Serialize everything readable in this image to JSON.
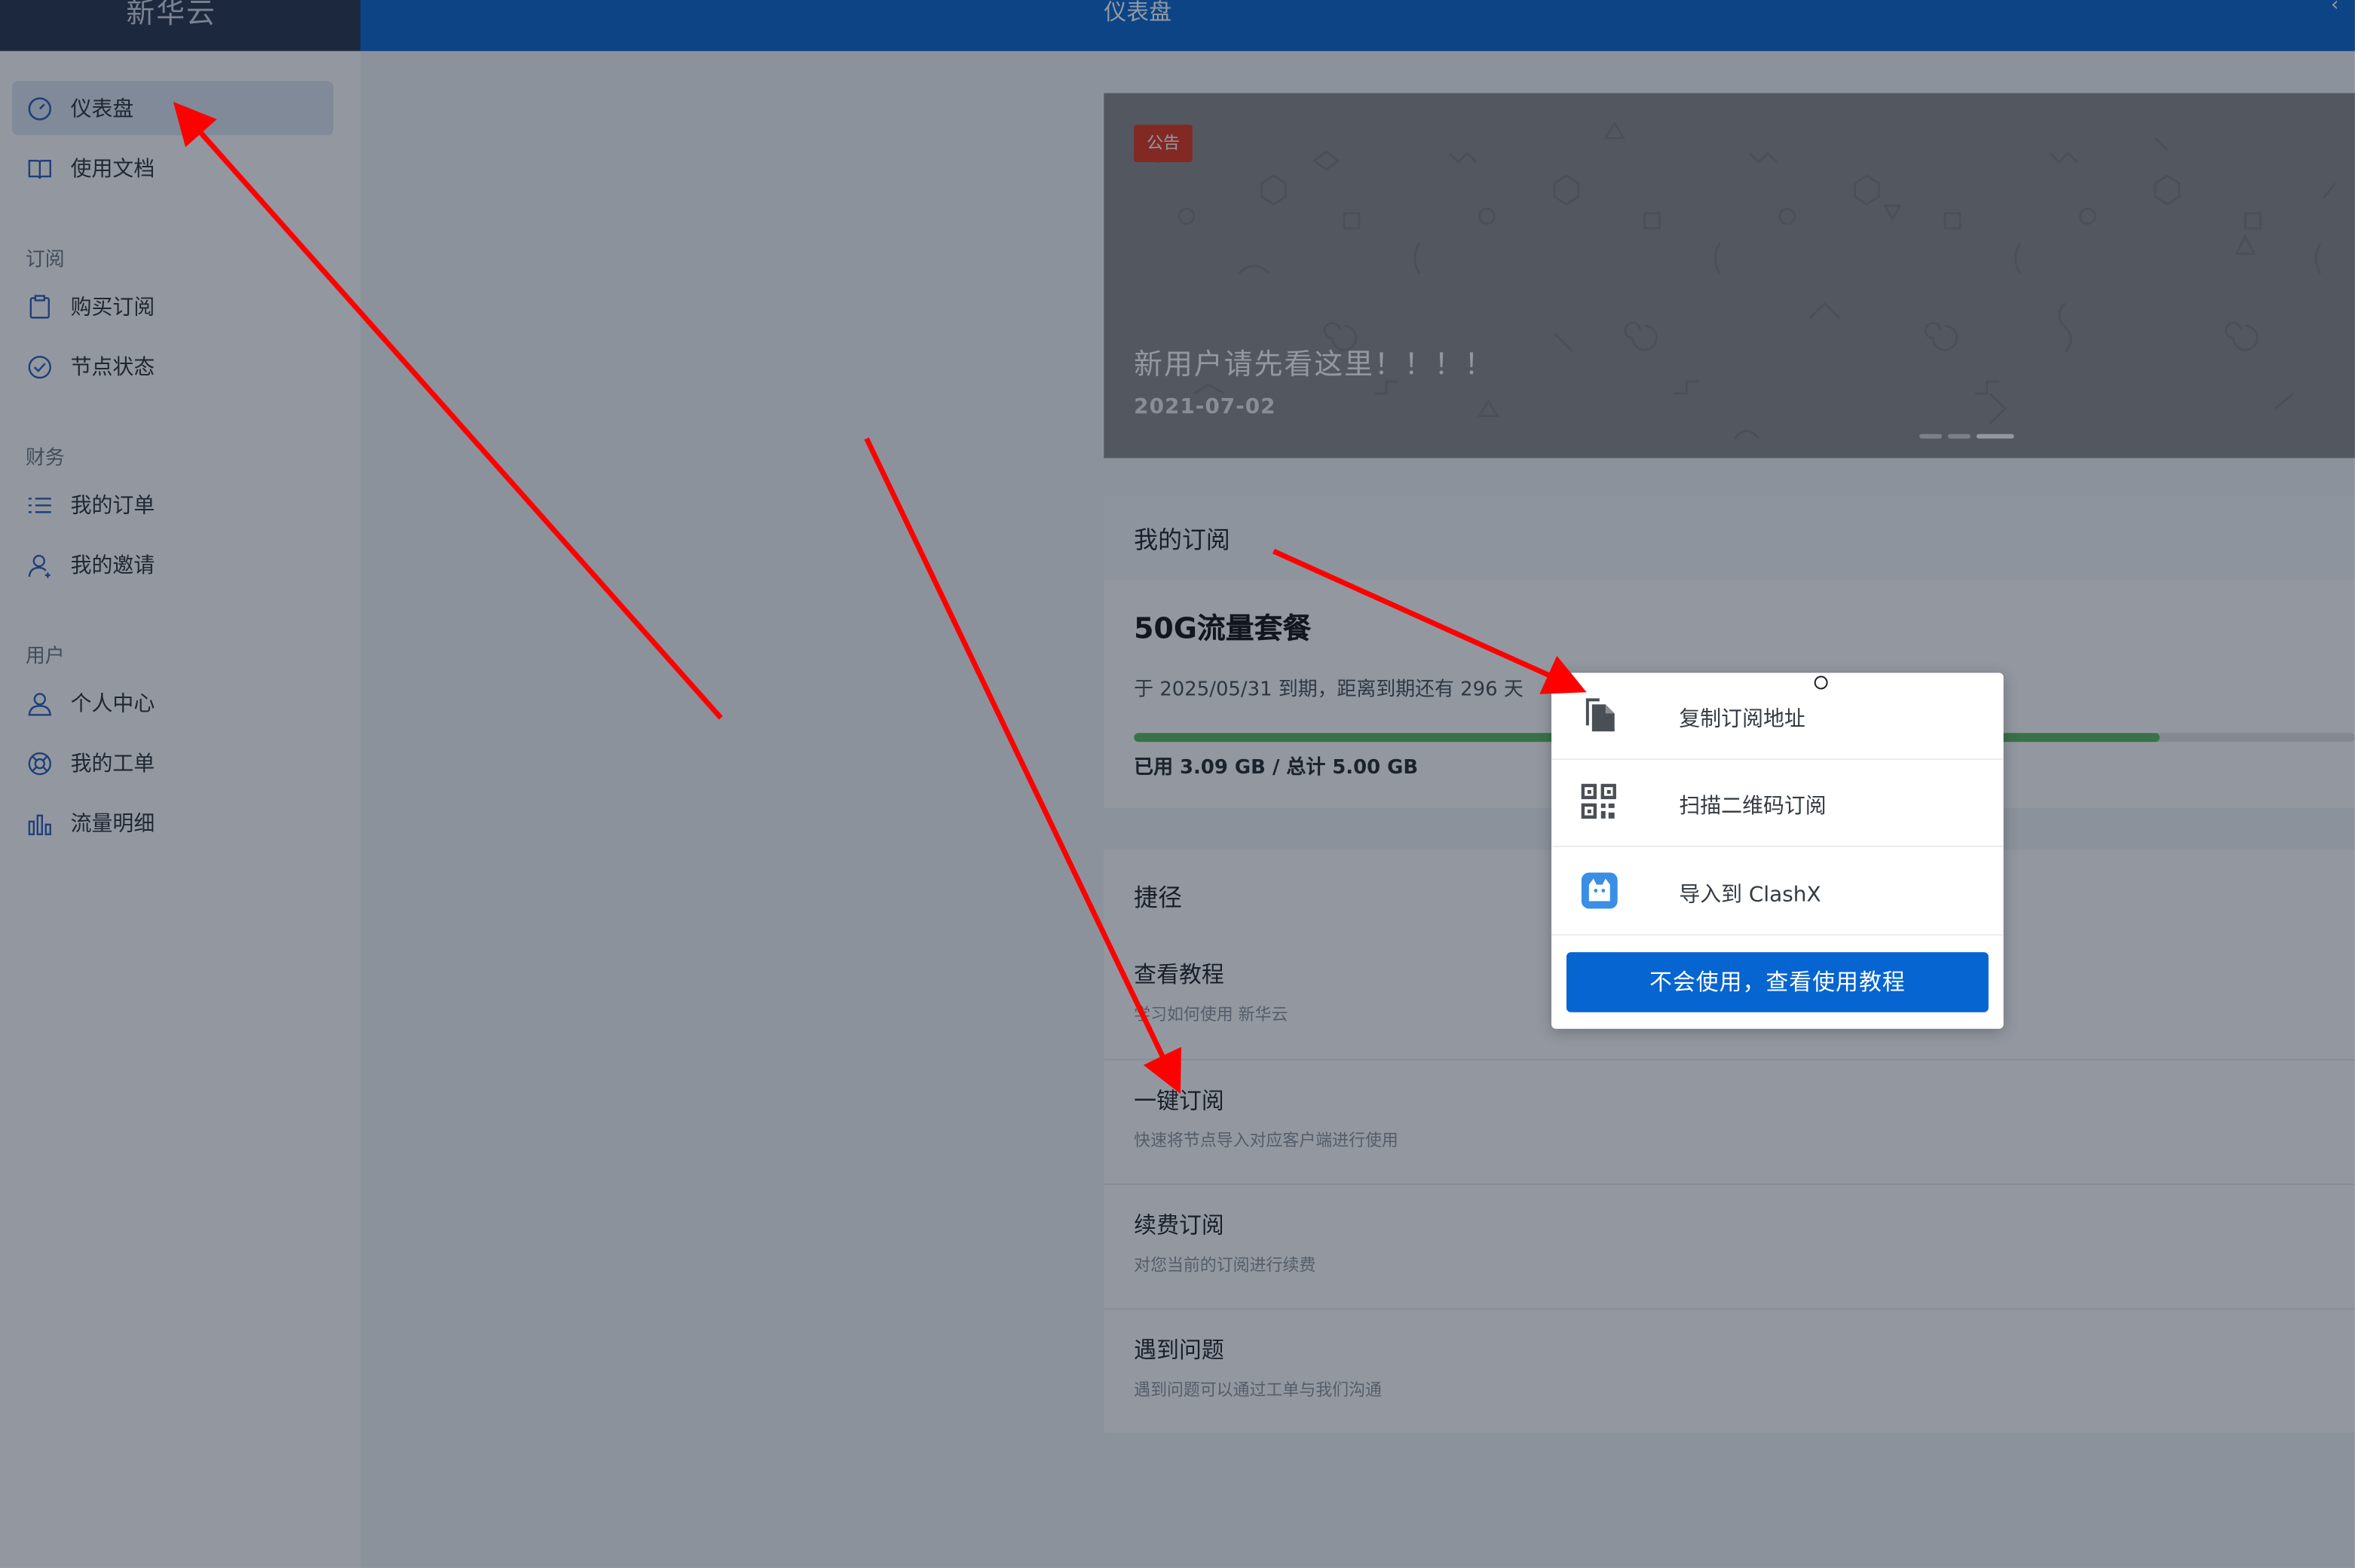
{
  "header": {
    "brand": "新华云",
    "title": "仪表盘"
  },
  "sidebar": {
    "items": [
      {
        "label": "仪表盘",
        "icon": "dashboard-icon",
        "active": true
      },
      {
        "label": "使用文档",
        "icon": "book-icon"
      }
    ],
    "groups": [
      {
        "title": "订阅",
        "items": [
          {
            "label": "购买订阅",
            "icon": "clipboard-icon"
          },
          {
            "label": "节点状态",
            "icon": "check-circle-icon"
          }
        ]
      },
      {
        "title": "财务",
        "items": [
          {
            "label": "我的订单",
            "icon": "list-icon"
          },
          {
            "label": "我的邀请",
            "icon": "user-invite-icon"
          }
        ]
      },
      {
        "title": "用户",
        "items": [
          {
            "label": "个人中心",
            "icon": "user-icon"
          },
          {
            "label": "我的工单",
            "icon": "lifebuoy-icon"
          },
          {
            "label": "流量明细",
            "icon": "bar-chart-icon"
          }
        ]
      }
    ]
  },
  "banner": {
    "tag": "公告",
    "title": "新用户请先看这里！！！！",
    "date": "2021-07-02",
    "slides": 3,
    "active_slide": 3
  },
  "subscription": {
    "header": "我的订阅",
    "plan_name": "50G流量套餐",
    "expire_text": "于 2025/05/31 到期，距离到期还有 296 天",
    "usage_text": "已用 3.09 GB / 总计 5.00 GB",
    "usage_fraction": 0.84
  },
  "shortcuts": {
    "header": "捷径",
    "items": [
      {
        "title": "查看教程",
        "subtitle": "学习如何使用 新华云"
      },
      {
        "title": "一键订阅",
        "subtitle": "快速将节点导入对应客户端进行使用"
      },
      {
        "title": "续费订阅",
        "subtitle": "对您当前的订阅进行续费"
      },
      {
        "title": "遇到问题",
        "subtitle": "遇到问题可以通过工单与我们沟通"
      }
    ]
  },
  "popup": {
    "items": [
      {
        "label": "复制订阅地址",
        "icon": "copy-icon"
      },
      {
        "label": "扫描二维码订阅",
        "icon": "qr-code-icon"
      },
      {
        "label": "导入到 ClashX",
        "icon": "clashx-cat-icon"
      }
    ],
    "button": "不会使用，查看使用教程"
  },
  "colors": {
    "primary": "#0665d0",
    "sidebar_brand": "#24314a",
    "tag": "#e0331a",
    "progress": "#5cb85c",
    "arrow": "#ff0000"
  }
}
